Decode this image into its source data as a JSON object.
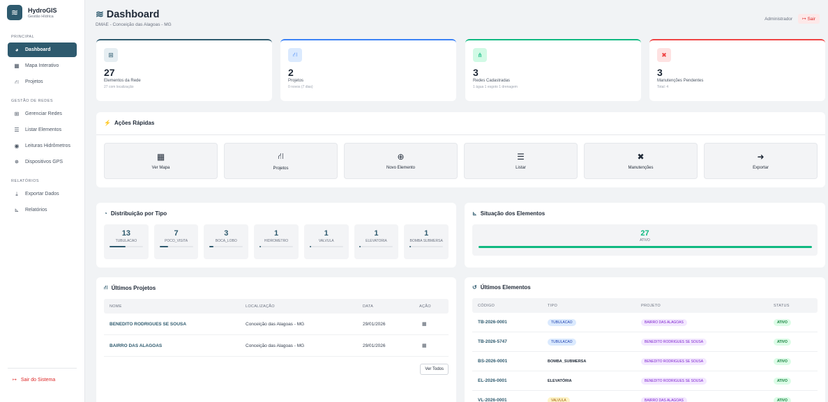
{
  "brand": {
    "title": "HydroGIS",
    "subtitle": "Gestão Hídrica"
  },
  "sidebar": {
    "sections": [
      {
        "title": "PRINCIPAL",
        "items": [
          {
            "label": "Dashboard",
            "icon": "gauge-icon",
            "active": true
          },
          {
            "label": "Mapa Interativo",
            "icon": "map-icon"
          },
          {
            "label": "Projetos",
            "icon": "project-diagram-icon"
          }
        ]
      },
      {
        "title": "GESTÃO DE REDES",
        "items": [
          {
            "label": "Gerenciar Redes",
            "icon": "network-icon"
          },
          {
            "label": "Listar Elementos",
            "icon": "list-icon"
          },
          {
            "label": "Leituras Hidrômetros",
            "icon": "meter-icon"
          },
          {
            "label": "Dispositivos GPS",
            "icon": "satellite-icon"
          }
        ]
      },
      {
        "title": "RELATÓRIOS",
        "items": [
          {
            "label": "Exportar Dados",
            "icon": "download-icon"
          },
          {
            "label": "Relatórios",
            "icon": "chart-icon"
          }
        ]
      }
    ],
    "logout": "Sair do Sistema"
  },
  "header": {
    "title": "Dashboard",
    "subtitle": "DMAE - Conceição das Alagoas - MG",
    "user": "Administrador",
    "logout": "Sair"
  },
  "stats": [
    {
      "value": "27",
      "label": "Elementos da Rede",
      "note": "27 com localização",
      "color": "#2e5a6e",
      "bg": "#e6eef2",
      "icon": "network-icon"
    },
    {
      "value": "2",
      "label": "Projetos",
      "note": "0 novos (7 dias)",
      "color": "#3b82f6",
      "bg": "#dbeafe",
      "icon": "project-diagram-icon"
    },
    {
      "value": "3",
      "label": "Redes Cadastradas",
      "note": "1 água 1 esgoto 1 drenagem",
      "color": "#10b981",
      "bg": "#d1fae5",
      "icon": "sitemap-icon"
    },
    {
      "value": "3",
      "label": "Manutenções Pendentes",
      "note": "Total: 4",
      "color": "#ef4444",
      "bg": "#fee2e2",
      "icon": "tools-icon"
    }
  ],
  "quick_actions": {
    "title": "Ações Rápidas",
    "items": [
      {
        "label": "Ver Mapa",
        "icon": "map-icon"
      },
      {
        "label": "Projetos",
        "icon": "project-diagram-icon"
      },
      {
        "label": "Novo Elemento",
        "icon": "plus-circle-icon"
      },
      {
        "label": "Listar",
        "icon": "list-icon"
      },
      {
        "label": "Manutenções",
        "icon": "tools-icon"
      },
      {
        "label": "Exportar",
        "icon": "export-icon"
      }
    ]
  },
  "distribution": {
    "title": "Distribuição por Tipo",
    "items": [
      {
        "value": "13",
        "label": "TUBULACAO",
        "share": 0.48
      },
      {
        "value": "7",
        "label": "POCO_VISITA",
        "share": 0.26
      },
      {
        "value": "3",
        "label": "BOCA_LOBO",
        "share": 0.11
      },
      {
        "value": "1",
        "label": "HIDROMETRO",
        "share": 0.04
      },
      {
        "value": "1",
        "label": "VALVULA",
        "share": 0.04
      },
      {
        "value": "1",
        "label": "ELEVATORIA",
        "share": 0.04
      },
      {
        "value": "1",
        "label": "BOMBA SUBMERSA",
        "share": 0.04
      }
    ]
  },
  "situation": {
    "title": "Situação dos Elementos",
    "value": "27",
    "label": "ATIVO",
    "share": 1.0
  },
  "projects": {
    "title": "Últimos Projetos",
    "headers": [
      "NOME",
      "LOCALIZAÇÃO",
      "DATA",
      "AÇÃO"
    ],
    "rows": [
      {
        "name": "BENEDITO RODRIGUES SE SOUSA",
        "location": "Conceição das Alagoas - MG",
        "date": "29/01/2026"
      },
      {
        "name": "BAIRRO DAS ALAGOAS",
        "location": "Conceição das Alagoas - MG",
        "date": "29/01/2026"
      }
    ],
    "view_all": "Ver Todos"
  },
  "elements": {
    "title": "Últimos Elementos",
    "headers": [
      "CÓDIGO",
      "TIPO",
      "PROJETO",
      "STATUS"
    ],
    "rows": [
      {
        "code": "TB-2026-0001",
        "type": "TUBULACAO",
        "type_badge": true,
        "project": "BAIRRO DAS ALAGOAS",
        "status": "ATIVO"
      },
      {
        "code": "TB-2026-5747",
        "type": "TUBULACAO",
        "type_badge": true,
        "project": "BENEDITO RODRIGUES SE SOUSA",
        "status": "ATIVO"
      },
      {
        "code": "BS-2026-0001",
        "type": "BOMBA_SUBMERSA",
        "type_badge": false,
        "project": "BENEDITO RODRIGUES SE SOUSA",
        "status": "ATIVO"
      },
      {
        "code": "EL-2026-0001",
        "type": "ELEVATÓRIA",
        "type_badge": false,
        "project": "BENEDITO RODRIGUES SE SOUSA",
        "status": "ATIVO"
      },
      {
        "code": "VL-2026-0001",
        "type": "VALVULA",
        "type_badge": true,
        "project": "BAIRRO DAS ALAGOAS",
        "status": "ATIVO"
      }
    ]
  }
}
